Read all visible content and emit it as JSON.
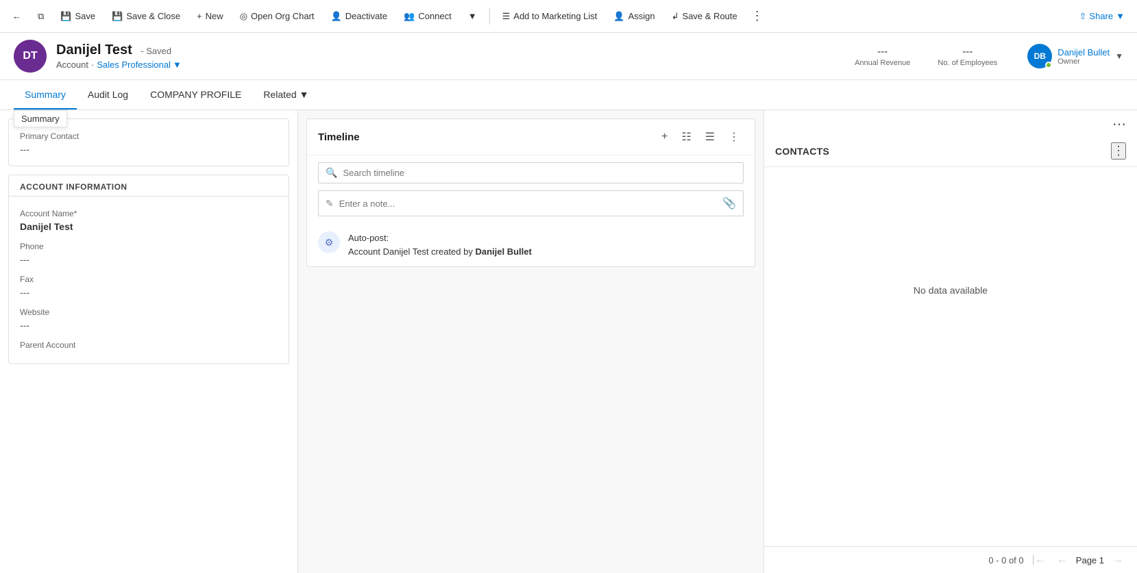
{
  "toolbar": {
    "back_label": "←",
    "copy_label": "⧉",
    "save_label": "Save",
    "save_close_label": "Save & Close",
    "new_label": "New",
    "org_chart_label": "Open Org Chart",
    "deactivate_label": "Deactivate",
    "connect_label": "Connect",
    "connect_dropdown": "▾",
    "marketing_list_label": "Add to Marketing List",
    "assign_label": "Assign",
    "save_route_label": "Save & Route",
    "more_label": "⋮",
    "share_label": "Share",
    "share_dropdown": "▾"
  },
  "record": {
    "initials": "DT",
    "title": "Danijel Test",
    "status": "Saved",
    "entity": "Account",
    "type": "Sales Professional",
    "annual_revenue_label": "Annual Revenue",
    "annual_revenue_value": "---",
    "employees_label": "No. of Employees",
    "employees_value": "---",
    "owner_initials": "DB",
    "owner_name": "Danijel Bullet",
    "owner_label": "Owner"
  },
  "nav": {
    "summary_label": "Summary",
    "audit_log_label": "Audit Log",
    "company_profile_label": "COMPANY PROFILE",
    "related_label": "Related",
    "tooltip_summary": "Summary"
  },
  "left_panel": {
    "primary_contact_label": "Primary Contact",
    "primary_contact_value": "---",
    "section_title": "ACCOUNT INFORMATION",
    "account_name_label": "Account Name*",
    "account_name_value": "Danijel Test",
    "phone_label": "Phone",
    "phone_value": "---",
    "fax_label": "Fax",
    "fax_value": "---",
    "website_label": "Website",
    "website_value": "---",
    "parent_account_label": "Parent Account"
  },
  "timeline": {
    "title": "Timeline",
    "search_placeholder": "Search timeline",
    "note_placeholder": "Enter a note...",
    "autopost_text": "Auto-post:",
    "autopost_detail": "Account Danijel Test created by ",
    "autopost_author": "Danijel Bullet"
  },
  "right_panel": {
    "contacts_title": "CONTACTS",
    "no_data_label": "No data available",
    "pagination_label": "0 - 0 of 0",
    "page_label": "Page 1"
  }
}
